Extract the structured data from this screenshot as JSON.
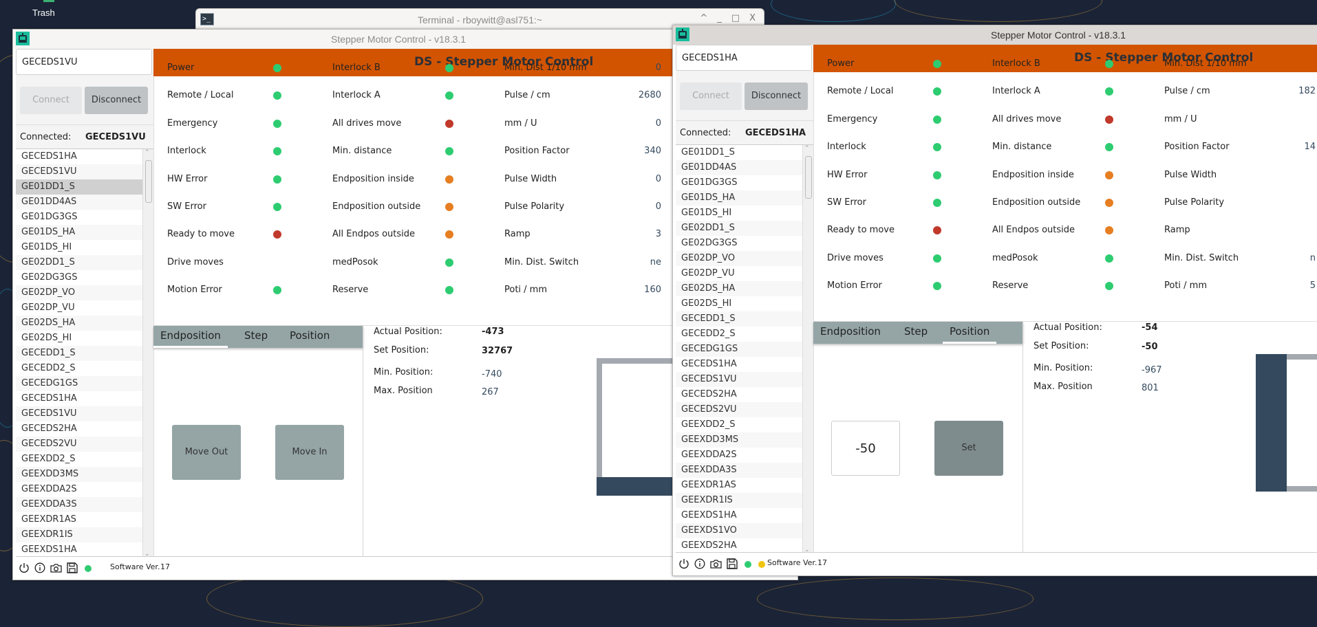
{
  "desktop": {
    "trash_label": "Trash"
  },
  "terminal": {
    "title": "Terminal - rboywitt@asl751:~",
    "icon": "terminal-icon",
    "buttons": [
      "^",
      "_",
      "□",
      "X"
    ]
  },
  "colors": {
    "header": "#d35400",
    "green": "#2ecc71",
    "red": "#c0392b",
    "orange": "#e67e22",
    "yellow": "#f1c40f",
    "tab_bar": "#95a5a6",
    "dark": "#34495e"
  },
  "windows": [
    {
      "title": "Stepper Motor Control - v18.3.1",
      "combo_value": "GECEDS1VU",
      "connect_label": "Connect",
      "disconnect_label": "Disconnect",
      "connected_label": "Connected:",
      "connected_value": "GECEDS1VU",
      "header": "DS - Stepper Motor Control",
      "devices": [
        "GECEDS1HA",
        "GECEDS1VU",
        "GE01DD1_S",
        "GE01DD4AS",
        "GE01DG3GS",
        "GE01DS_HA",
        "GE01DS_HI",
        "GE02DD1_S",
        "GE02DG3GS",
        "GE02DP_VO",
        "GE02DP_VU",
        "GE02DS_HA",
        "GE02DS_HI",
        "GECEDD1_S",
        "GECEDD2_S",
        "GECEDG1GS",
        "GECEDS1HA",
        "GECEDS1VU",
        "GECEDS2HA",
        "GECEDS2VU",
        "GEEXDD2_S",
        "GEEXDD3MS",
        "GEEXDDA2S",
        "GEEXDDA3S",
        "GEEXDR1AS",
        "GEEXDR1IS",
        "GEEXDS1HA"
      ],
      "selected_device": "GE01DD1_S",
      "status_col1": [
        {
          "label": "Power",
          "state": "green"
        },
        {
          "label": "Remote / Local",
          "state": "green"
        },
        {
          "label": "Emergency",
          "state": "green"
        },
        {
          "label": "Interlock",
          "state": "green"
        },
        {
          "label": "HW Error",
          "state": "green"
        },
        {
          "label": "SW Error",
          "state": "green"
        },
        {
          "label": "Ready to move",
          "state": "red"
        },
        {
          "label": "Drive moves",
          "state": "none"
        },
        {
          "label": "Motion Error",
          "state": "green"
        }
      ],
      "status_col2": [
        {
          "label": "Interlock B",
          "state": "green"
        },
        {
          "label": "Interlock A",
          "state": "green"
        },
        {
          "label": "All drives move",
          "state": "red"
        },
        {
          "label": "Min. distance",
          "state": "green"
        },
        {
          "label": "Endposition inside",
          "state": "orange"
        },
        {
          "label": "Endposition outside",
          "state": "orange"
        },
        {
          "label": "All Endpos outside",
          "state": "orange"
        },
        {
          "label": "medPosok",
          "state": "green"
        },
        {
          "label": "Reserve",
          "state": "green"
        }
      ],
      "params": [
        {
          "label": "Min. Dist 1/10 mm",
          "value": "0"
        },
        {
          "label": "Pulse / cm",
          "value": "2680"
        },
        {
          "label": "mm / U",
          "value": "0"
        },
        {
          "label": "Position Factor",
          "value": "340"
        },
        {
          "label": "Pulse Width",
          "value": "0"
        },
        {
          "label": "Pulse Polarity",
          "value": "0"
        },
        {
          "label": "Ramp",
          "value": "3"
        },
        {
          "label": "Min. Dist. Switch",
          "value": "ne"
        },
        {
          "label": "Poti / mm",
          "value": "160"
        }
      ],
      "tabs": [
        "Endposition",
        "Step",
        "Position"
      ],
      "active_tab": 0,
      "actual_label": "Actual Position:",
      "actual_value": "-473",
      "set_label": "Set Position:",
      "set_value": "32767",
      "min_label": "Min. Position:",
      "min_value": "-740",
      "max_label": "Max. Position",
      "max_value": "267",
      "btn_a": "Move Out",
      "btn_b": "Move In",
      "software_label": "Software Ver.",
      "software_value": "17",
      "status_dots": [
        "green"
      ]
    },
    {
      "title": "Stepper Motor Control - v18.3.1",
      "combo_value": "GECEDS1HA",
      "connect_label": "Connect",
      "disconnect_label": "Disconnect",
      "connected_label": "Connected:",
      "connected_value": "GECEDS1HA",
      "header": "DS - Stepper Motor Control",
      "devices": [
        "GE01DD1_S",
        "GE01DD4AS",
        "GE01DG3GS",
        "GE01DS_HA",
        "GE01DS_HI",
        "GE02DD1_S",
        "GE02DG3GS",
        "GE02DP_VO",
        "GE02DP_VU",
        "GE02DS_HA",
        "GE02DS_HI",
        "GECEDD1_S",
        "GECEDD2_S",
        "GECEDG1GS",
        "GECEDS1HA",
        "GECEDS1VU",
        "GECEDS2HA",
        "GECEDS2VU",
        "GEEXDD2_S",
        "GEEXDD3MS",
        "GEEXDDA2S",
        "GEEXDDA3S",
        "GEEXDR1AS",
        "GEEXDR1IS",
        "GEEXDS1HA",
        "GEEXDS1VO",
        "GEEXDS2HA"
      ],
      "selected_device": "",
      "status_col1": [
        {
          "label": "Power",
          "state": "green"
        },
        {
          "label": "Remote / Local",
          "state": "green"
        },
        {
          "label": "Emergency",
          "state": "green"
        },
        {
          "label": "Interlock",
          "state": "green"
        },
        {
          "label": "HW Error",
          "state": "green"
        },
        {
          "label": "SW Error",
          "state": "green"
        },
        {
          "label": "Ready to move",
          "state": "red"
        },
        {
          "label": "Drive moves",
          "state": "green"
        },
        {
          "label": "Motion Error",
          "state": "green"
        }
      ],
      "status_col2": [
        {
          "label": "Interlock B",
          "state": "green"
        },
        {
          "label": "Interlock A",
          "state": "green"
        },
        {
          "label": "All drives move",
          "state": "red"
        },
        {
          "label": "Min. distance",
          "state": "green"
        },
        {
          "label": "Endposition inside",
          "state": "orange"
        },
        {
          "label": "Endposition outside",
          "state": "orange"
        },
        {
          "label": "All Endpos outside",
          "state": "orange"
        },
        {
          "label": "medPosok",
          "state": "green"
        },
        {
          "label": "Reserve",
          "state": "green"
        }
      ],
      "params": [
        {
          "label": "Min. Dist 1/10 mm",
          "value": ""
        },
        {
          "label": "Pulse / cm",
          "value": "182"
        },
        {
          "label": "mm / U",
          "value": ""
        },
        {
          "label": "Position Factor",
          "value": "14"
        },
        {
          "label": "Pulse Width",
          "value": ""
        },
        {
          "label": "Pulse Polarity",
          "value": ""
        },
        {
          "label": "Ramp",
          "value": ""
        },
        {
          "label": "Min. Dist. Switch",
          "value": "n"
        },
        {
          "label": "Poti / mm",
          "value": "5"
        }
      ],
      "tabs": [
        "Endposition",
        "Step",
        "Position"
      ],
      "active_tab": 2,
      "actual_label": "Actual Position:",
      "actual_value": "-54",
      "set_label": "Set Position:",
      "set_value": "-50",
      "min_label": "Min. Position:",
      "min_value": "-967",
      "max_label": "Max. Position",
      "max_value": "801",
      "input_value": "-50",
      "btn_b": "Set",
      "software_label": "Software Ver.",
      "software_value": "17",
      "status_dots": [
        "green",
        "yellow"
      ]
    }
  ]
}
